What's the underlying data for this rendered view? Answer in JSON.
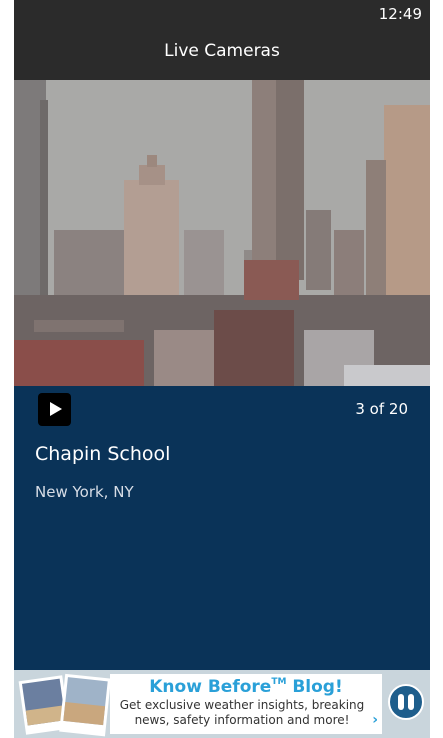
{
  "status_bar": {
    "time": "12:49"
  },
  "header": {
    "title": "Live Cameras"
  },
  "camera": {
    "name": "Chapin School",
    "location": "New York, NY",
    "counter": "3 of 20",
    "play_icon": "play-icon"
  },
  "ad": {
    "headline": "Know Before",
    "trademark": "TM",
    "headline_suffix": " Blog!",
    "line1": "Get exclusive weather insights, breaking",
    "line2": "news, safety information and more!",
    "chevron_icon": "chevron-right-icon",
    "logo_icon": "weather-logo-icon"
  },
  "colors": {
    "top_bar": "#2b2b2b",
    "info_panel": "#0a3358",
    "ad_accent": "#2aa0d8"
  }
}
